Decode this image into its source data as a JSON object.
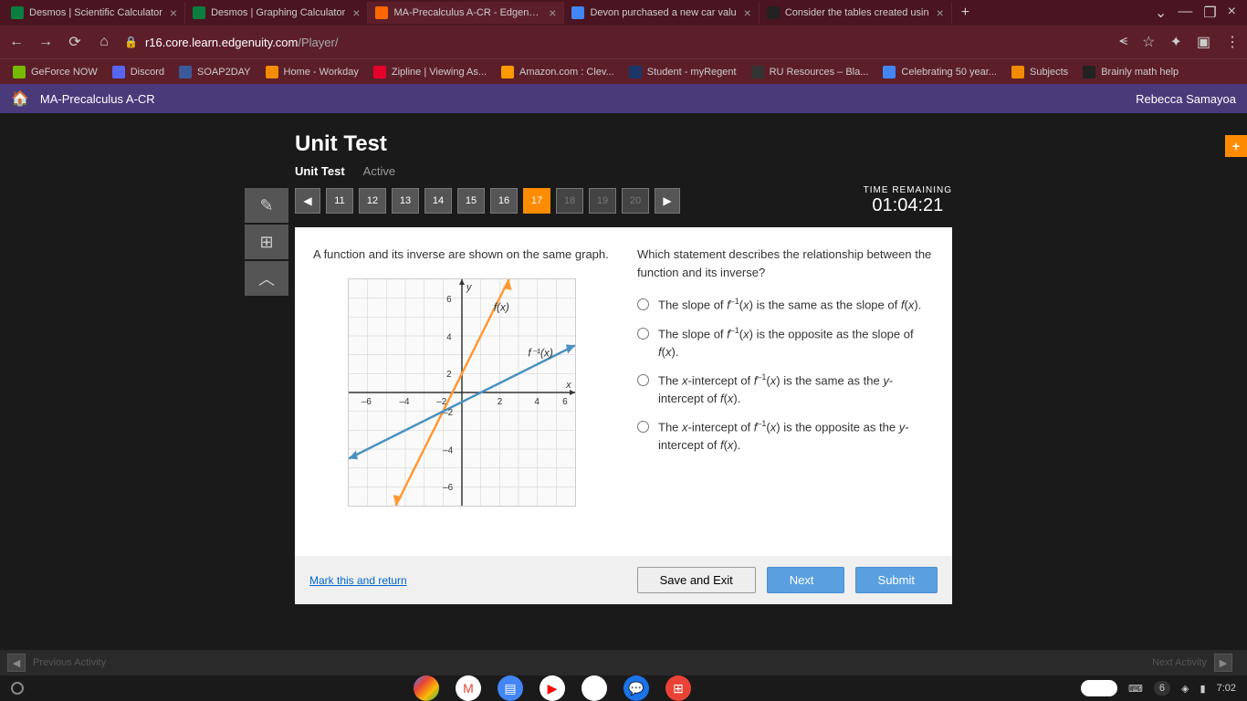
{
  "tabs": [
    {
      "title": "Desmos | Scientific Calculator",
      "icon_bg": "#0a7d3f"
    },
    {
      "title": "Desmos | Graphing Calculator",
      "icon_bg": "#0a7d3f"
    },
    {
      "title": "MA-Precalculus A-CR - Edgenuity",
      "icon_bg": "#ff6600",
      "active": true
    },
    {
      "title": "Devon purchased a new car valu",
      "icon_bg": "#4285f4"
    },
    {
      "title": "Consider the tables created usin",
      "icon_bg": "#222"
    }
  ],
  "url": {
    "domain": "r16.core.learn.edgenuity.com",
    "path": "/Player/"
  },
  "bookmarks": [
    {
      "label": "GeForce NOW",
      "bg": "#76b900"
    },
    {
      "label": "Discord",
      "bg": "#5865f2"
    },
    {
      "label": "SOAP2DAY",
      "bg": "#3b5998"
    },
    {
      "label": "Home - Workday",
      "bg": "#f38b00"
    },
    {
      "label": "Zipline | Viewing As...",
      "bg": "#e4002b"
    },
    {
      "label": "Amazon.com : Clev...",
      "bg": "#ff9900"
    },
    {
      "label": "Student - myRegent",
      "bg": "#1a3668"
    },
    {
      "label": "RU Resources – Bla...",
      "bg": "#333"
    },
    {
      "label": "Celebrating 50 year...",
      "bg": "#4285f4"
    },
    {
      "label": "Subjects",
      "bg": "#f38b00"
    },
    {
      "label": "Brainly math help",
      "bg": "#222"
    }
  ],
  "app": {
    "course": "MA-Precalculus A-CR",
    "user": "Rebecca Samayoa"
  },
  "unit": {
    "title": "Unit Test",
    "tab1": "Unit Test",
    "tab2": "Active"
  },
  "questions": {
    "visible": [
      "11",
      "12",
      "13",
      "14",
      "15",
      "16",
      "17",
      "18",
      "19",
      "20"
    ],
    "current": "17"
  },
  "timer": {
    "label": "TIME REMAINING",
    "value": "01:04:21"
  },
  "question": {
    "left_text": "A function and its inverse are shown on the same graph.",
    "right_text": "Which statement describes the relationship between the function and its inverse?",
    "options": [
      "The slope of f⁻¹(x) is the same as the slope of f(x).",
      "The slope of f⁻¹(x) is the opposite as the slope of f(x).",
      "The x-intercept of f⁻¹(x) is the same as the y-intercept of f(x).",
      "The x-intercept of f⁻¹(x) is the opposite as the y-intercept of f(x)."
    ]
  },
  "chart_data": {
    "type": "line",
    "xlim": [
      -6,
      6
    ],
    "ylim": [
      -6,
      6
    ],
    "xlabel": "x",
    "ylabel": "y",
    "series": [
      {
        "name": "f(x)",
        "color": "#ff9933",
        "points": [
          [
            -3.5,
            -6
          ],
          [
            -0.5,
            0
          ],
          [
            2.5,
            6
          ]
        ]
      },
      {
        "name": "f⁻¹(x)",
        "color": "#4a90c0",
        "points": [
          [
            -6,
            -3.5
          ],
          [
            0,
            -0.5
          ],
          [
            6,
            2.5
          ]
        ]
      }
    ]
  },
  "buttons": {
    "mark": "Mark this and return",
    "save": "Save and Exit",
    "next": "Next",
    "submit": "Submit"
  },
  "activity": {
    "prev": "Previous Activity",
    "next": "Next Activity"
  },
  "taskbar": {
    "count": "6",
    "time": "7:02"
  }
}
